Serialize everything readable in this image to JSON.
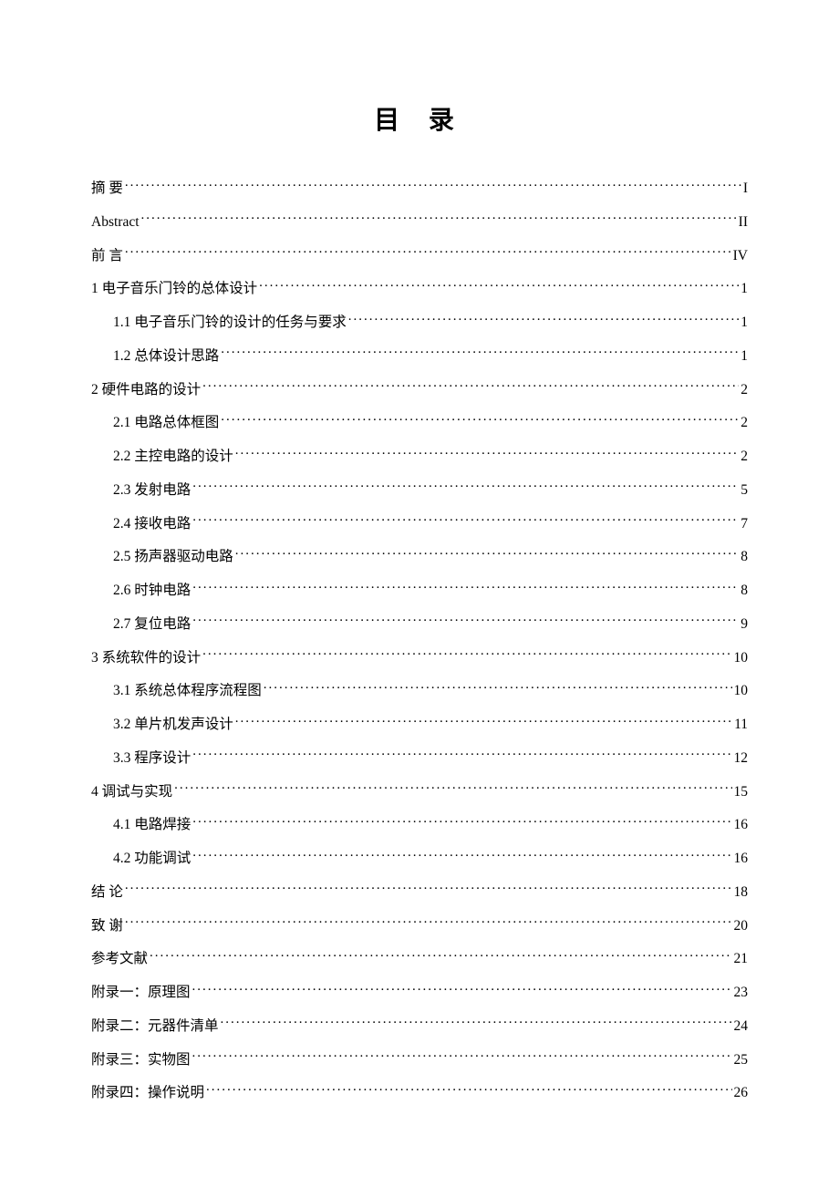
{
  "title": "目 录",
  "toc": [
    {
      "level": 1,
      "label": "摘  要",
      "page": "I",
      "spaced": false
    },
    {
      "level": 1,
      "label": "Abstract",
      "page": "II",
      "spaced": false
    },
    {
      "level": 1,
      "label": "前  言",
      "page": "IV",
      "spaced": false
    },
    {
      "level": 1,
      "label": "1  电子音乐门铃的总体设计",
      "page": "1",
      "spaced": false
    },
    {
      "level": 2,
      "label": "1.1  电子音乐门铃的设计的任务与要求",
      "page": "1",
      "spaced": false
    },
    {
      "level": 2,
      "label": "1.2  总体设计思路",
      "page": "1",
      "spaced": false
    },
    {
      "level": 1,
      "label": "2    硬件电路的设计",
      "page": "2",
      "spaced": false
    },
    {
      "level": 2,
      "label": "2.1  电路总体框图",
      "page": "2",
      "spaced": false
    },
    {
      "level": 2,
      "label": "2.2  主控电路的设计",
      "page": "2",
      "spaced": false
    },
    {
      "level": 2,
      "label": "2.3  发射电路",
      "page": "5",
      "spaced": false
    },
    {
      "level": 2,
      "label": "2.4  接收电路",
      "page": "7",
      "spaced": false
    },
    {
      "level": 2,
      "label": "2.5  扬声器驱动电路",
      "page": "8",
      "spaced": false
    },
    {
      "level": 2,
      "label": "2.6  时钟电路",
      "page": "8",
      "spaced": false
    },
    {
      "level": 2,
      "label": "2.7  复位电路",
      "page": "9",
      "spaced": false
    },
    {
      "level": 1,
      "label": "3  系统软件的设计",
      "page": "10",
      "spaced": false
    },
    {
      "level": 2,
      "label": "3.1  系统总体程序流程图",
      "page": "10",
      "spaced": false
    },
    {
      "level": 2,
      "label": "3.2  单片机发声设计",
      "page": "11",
      "spaced": false
    },
    {
      "level": 2,
      "label": "3.3 程序设计",
      "page": "12",
      "spaced": false
    },
    {
      "level": 1,
      "label": "4  调试与实现",
      "page": "15",
      "spaced": false
    },
    {
      "level": 2,
      "label": "4.1  电路焊接",
      "page": "16",
      "spaced": false
    },
    {
      "level": 2,
      "label": "4.2  功能调试",
      "page": "16",
      "spaced": false
    },
    {
      "level": 1,
      "label": "结  论",
      "page": "18",
      "spaced": false
    },
    {
      "level": 1,
      "label": "致  谢",
      "page": "20",
      "spaced": false
    },
    {
      "level": 1,
      "label": "参考文献",
      "page": "21",
      "spaced": false
    },
    {
      "level": 1,
      "label": "附录一：原理图",
      "page": "23",
      "spaced": false
    },
    {
      "level": 1,
      "label": "附录二：元器件清单",
      "page": "24",
      "spaced": false
    },
    {
      "level": 1,
      "label": "附录三：实物图",
      "page": "25",
      "spaced": false
    },
    {
      "level": 1,
      "label": "附录四：操作说明",
      "page": "26",
      "spaced": false
    }
  ]
}
